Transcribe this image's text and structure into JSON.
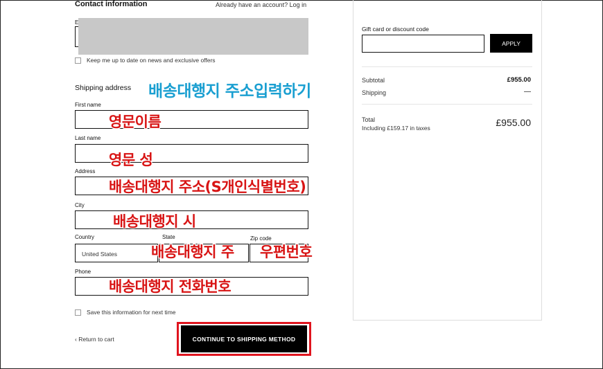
{
  "contact": {
    "title": "Contact information",
    "login_prompt": "Already have an account? Log in",
    "email_label": "E",
    "newsletter_label": "Keep me up to date on news and exclusive offers"
  },
  "shipping": {
    "title": "Shipping address",
    "first_name_label": "First name",
    "last_name_label": "Last name",
    "address_label": "Address",
    "city_label": "City",
    "country_label": "Country",
    "country_value": "United States",
    "state_label": "State",
    "zip_label": "Zip code",
    "phone_label": "Phone",
    "save_info_label": "Save this information for next time"
  },
  "actions": {
    "return_label": "Return to cart",
    "continue_label": "CONTINUE TO SHIPPING METHOD"
  },
  "summary": {
    "gift_label": "Gift card or discount code",
    "apply_label": "APPLY",
    "subtotal_label": "Subtotal",
    "subtotal_value": "£955.00",
    "shipping_label": "Shipping",
    "shipping_value": "—",
    "total_label": "Total",
    "taxes_note": "Including £159.17 in taxes",
    "total_value": "£955.00"
  },
  "annotations": {
    "shipping_heading": "배송대행지 주소입력하기",
    "first_name": "영문이름",
    "last_name": "영문 성",
    "address": "배송대행지 주소(S개인식별번호)",
    "city": "배송대행지 시",
    "state": "배송대행지 주",
    "zip": "우편번호",
    "phone": "배송대행지 전화번호"
  },
  "colors": {
    "annotation_red": "#d81414",
    "annotation_blue": "#1a9fd1",
    "button_bg": "#000000",
    "highlight_border": "#e0141e",
    "redact_gray": "#c8c8c8"
  }
}
